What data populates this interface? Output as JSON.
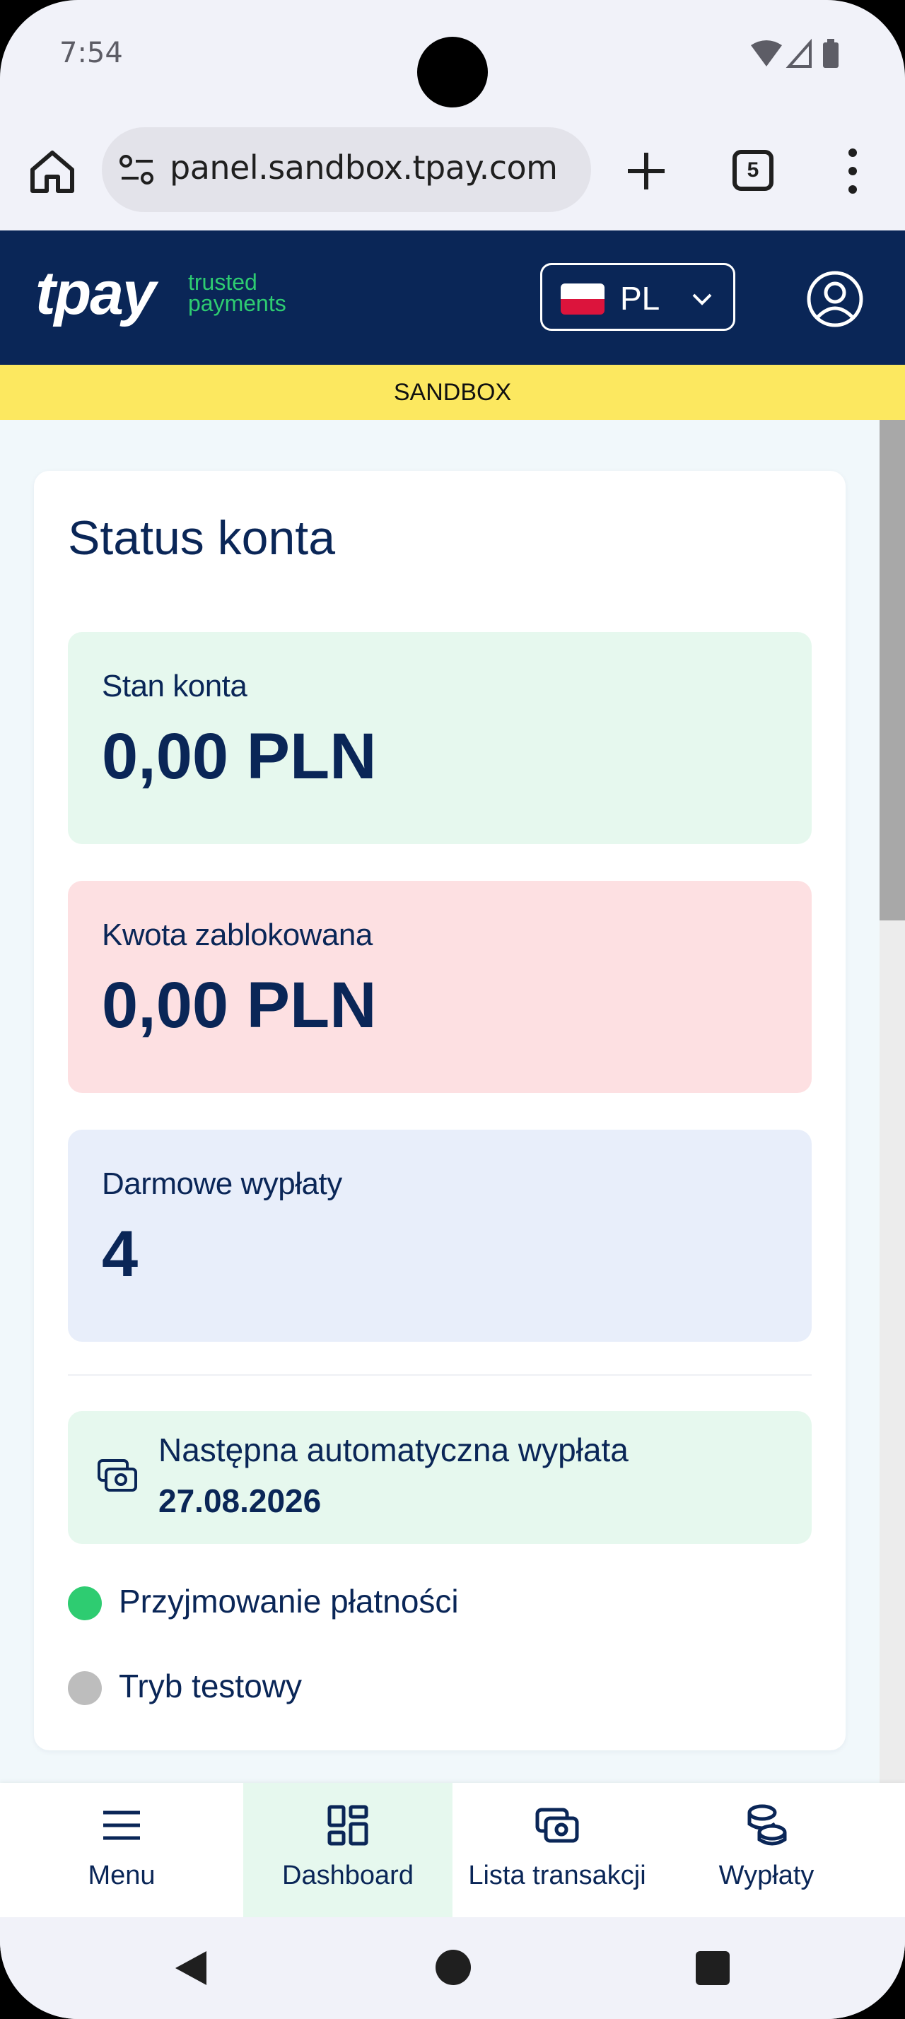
{
  "status_bar": {
    "time": "7:54"
  },
  "browser": {
    "url": "panel.sandbox.tpay.com",
    "tab_count": "5"
  },
  "header": {
    "logo": "tpay",
    "tagline_line1": "trusted",
    "tagline_line2": "payments",
    "language": "PL",
    "sandbox_label": "SANDBOX"
  },
  "account_status": {
    "title": "Status konta",
    "balance": {
      "label": "Stan konta",
      "value": "0,00 PLN"
    },
    "blocked": {
      "label": "Kwota zablokowana",
      "value": "0,00 PLN"
    },
    "free_payouts": {
      "label": "Darmowe wypłaty",
      "value": "4"
    },
    "next_payout": {
      "label": "Następna automatyczna wypłata",
      "date": "27.08.2026"
    },
    "statuses": [
      {
        "label": "Przyjmowanie płatności",
        "color": "#2ecc71"
      },
      {
        "label": "Tryb testowy",
        "color": "#bdbdbd"
      }
    ]
  },
  "bottom_nav": {
    "items": [
      {
        "label": "Menu",
        "icon": "menu-icon"
      },
      {
        "label": "Dashboard",
        "icon": "dashboard-icon",
        "active": true
      },
      {
        "label": "Lista transakcji",
        "icon": "cash-icon"
      },
      {
        "label": "Wypłaty",
        "icon": "coins-icon"
      }
    ]
  },
  "colors": {
    "brand_navy": "#0a2657",
    "brand_green": "#2ecc71",
    "sandbox_yellow": "#fce860"
  }
}
